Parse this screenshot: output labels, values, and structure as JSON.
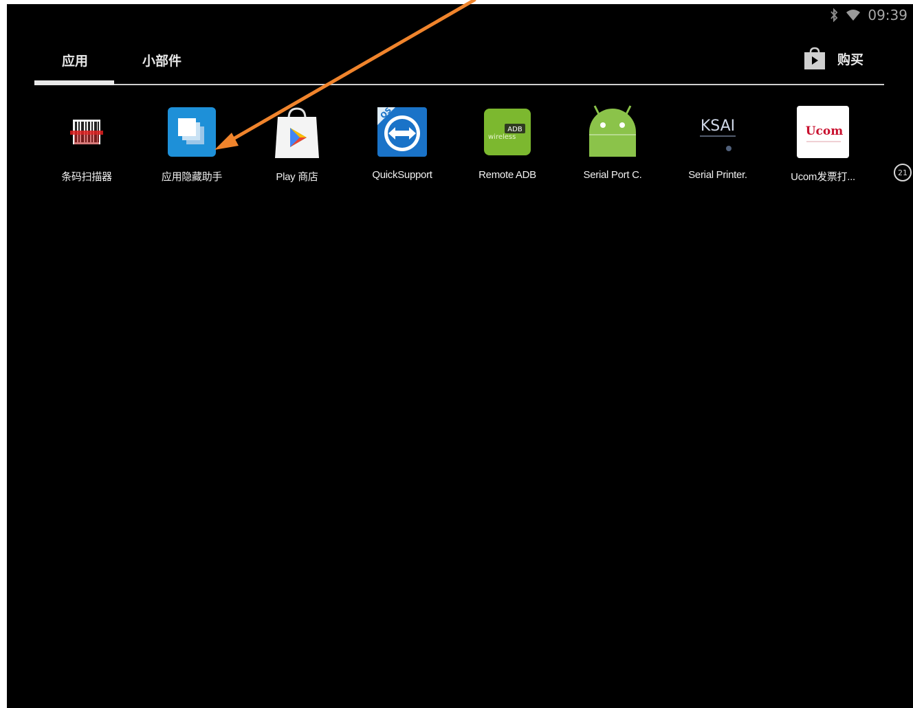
{
  "status_bar": {
    "time": "09:39",
    "icons": [
      "bluetooth-icon",
      "wifi-icon"
    ]
  },
  "tabs": [
    {
      "label": "应用",
      "selected": true
    },
    {
      "label": "小部件",
      "selected": false
    }
  ],
  "store": {
    "label": "购买",
    "icon": "play-store-bag-icon"
  },
  "apps": [
    {
      "label": "条码扫描器",
      "icon": "barcode-scanner-icon"
    },
    {
      "label": "应用隐藏助手",
      "icon": "app-hide-helper-icon"
    },
    {
      "label": "Play 商店",
      "icon": "play-store-icon"
    },
    {
      "label": "QuickSupport",
      "icon": "quicksupport-icon"
    },
    {
      "label": "Remote ADB",
      "icon": "remote-adb-icon",
      "icon_text": "ADB"
    },
    {
      "label": "Serial Port C.",
      "icon": "android-robot-icon"
    },
    {
      "label": "Serial Printer.",
      "icon": "ksai-icon",
      "icon_text": "KSAI"
    },
    {
      "label": "Ucom发票打...",
      "icon": "ucom-icon",
      "icon_text": "Ucom"
    }
  ],
  "page_indicator": "21",
  "annotation": {
    "color": "#F0842C",
    "points_to": "应用隐藏助手"
  }
}
